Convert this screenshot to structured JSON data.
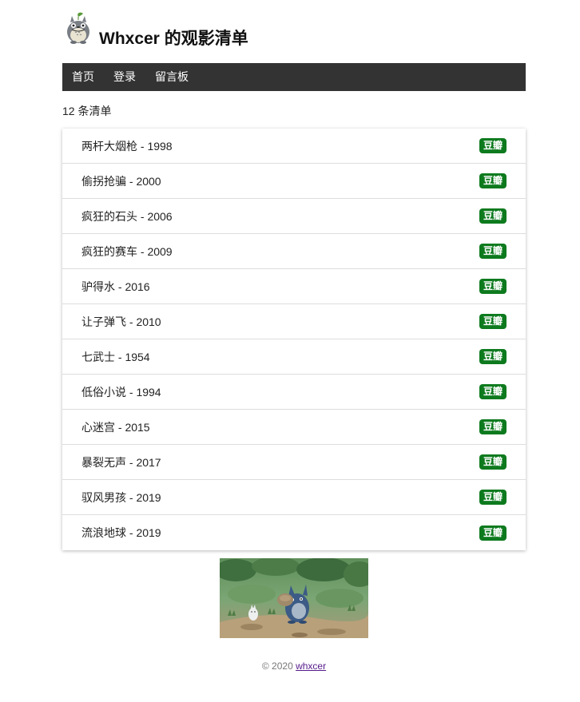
{
  "site": {
    "title": "Whxcer 的观影清单"
  },
  "nav": {
    "items": [
      {
        "label": "首页"
      },
      {
        "label": "登录"
      },
      {
        "label": "留言板"
      }
    ]
  },
  "list": {
    "count_text": "12 条清单",
    "badge_label": "豆瓣",
    "movies": [
      {
        "title": "两杆大烟枪 - 1998"
      },
      {
        "title": "偷拐抢骗 - 2000"
      },
      {
        "title": "疯狂的石头 - 2006"
      },
      {
        "title": "疯狂的赛车 - 2009"
      },
      {
        "title": "驴得水 - 2016"
      },
      {
        "title": "让子弹飞 - 2010"
      },
      {
        "title": "七武士 - 1954"
      },
      {
        "title": "低俗小说 - 1994"
      },
      {
        "title": "心迷宫 - 2015"
      },
      {
        "title": "暴裂无声 - 2017"
      },
      {
        "title": "驭风男孩 - 2019"
      },
      {
        "title": "流浪地球 - 2019"
      }
    ]
  },
  "footer": {
    "copyright": "© 2020",
    "author_link": "whxcer"
  },
  "colors": {
    "navbar_bg": "#333333",
    "badge_bg": "#0d7a1e",
    "link": "#551a8b"
  },
  "icons": {
    "avatar": "totoro-avatar-icon",
    "footer_image": "totoro-scene-image"
  }
}
